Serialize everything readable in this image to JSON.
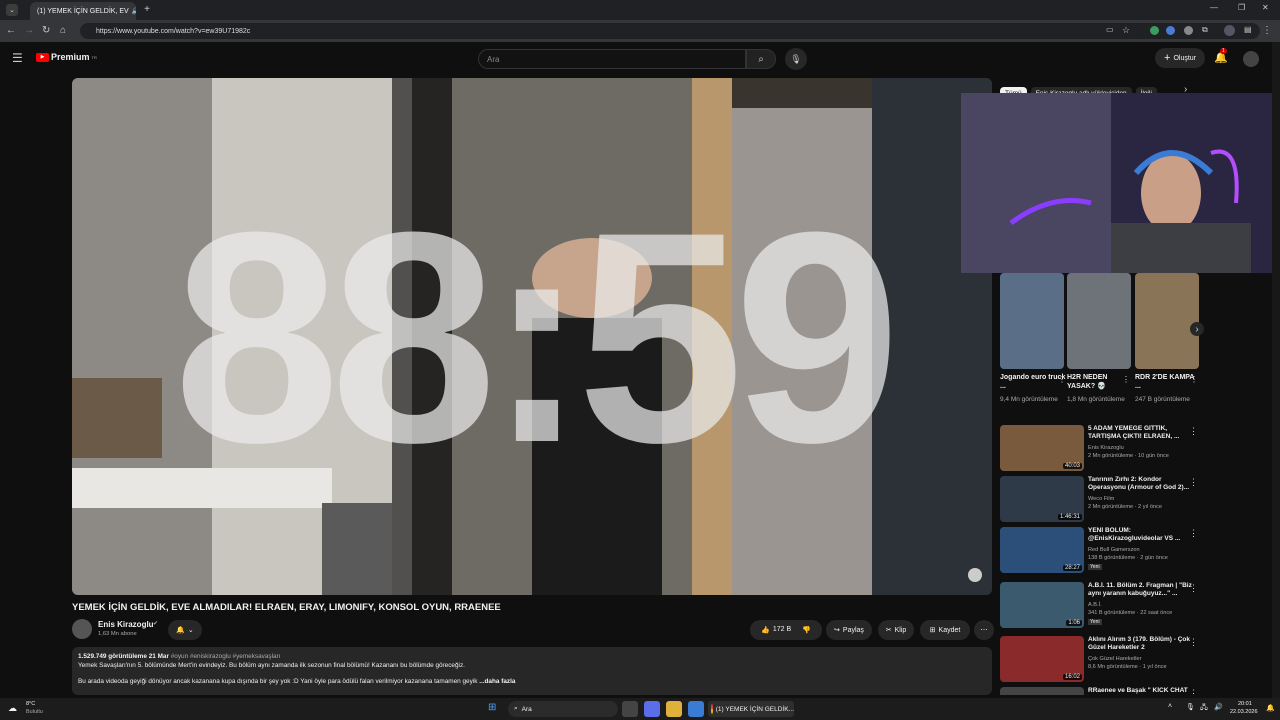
{
  "browser": {
    "tab_title": "(1) YEMEK İÇİN GELDİK, EV",
    "url": "https://www.youtube.com/watch?v=ew39U71982c"
  },
  "youtube": {
    "logo": "Premium",
    "logo_sup": "TR",
    "search_placeholder": "Ara",
    "create_label": "Oluştur",
    "notif_count": "1"
  },
  "video": {
    "timer": "88:59",
    "title": "YEMEK İÇİN GELDİK, EVE ALMADILAR! ELRAEN, ERAY, LIMONIFY, KONSOL OYUN, RRAENEE",
    "channel": "Enis Kirazoglu",
    "subs": "1,63 Mn abone",
    "likes": "172 B",
    "share": "Paylaş",
    "clip": "Klip",
    "save": "Kaydet"
  },
  "description": {
    "views": "1.529.749 görüntüleme",
    "date": "21 Mar",
    "tags": "#oyun #eniskirazoglu #yemeksavaşları",
    "line1": "Yemek Savaşları'nın 5. bölümünde Mert'in evindeyiz. Bu bölüm aynı zamanda ilk sezonun final bölümü! Kazananı bu bölümde göreceğiz.",
    "line2": "Bu arada videoda geyiği dönüyor ancak kazanana kupa dışında bir şey yok :D Yani öyle para ödülü falan verilmiyor kazanana tamamen geyik",
    "more": "...daha fazla"
  },
  "chips": [
    "Tümü",
    "Enis Kirazoglu adlı yükleyiciden",
    "İlgili"
  ],
  "shorts": [
    {
      "title": "Jogando euro truck ...",
      "views": "9,4 Mn görüntüleme",
      "color": "#5a6e88"
    },
    {
      "title": "H2R NEDEN YASAK? 💀",
      "views": "1,8 Mn görüntüleme",
      "color": "#6d7378"
    },
    {
      "title": "RDR 2'DE KAMPA ...",
      "views": "247 B görüntüleme",
      "color": "#8a7458"
    }
  ],
  "recs": [
    {
      "title": "5 ADAM YEMEĞE GİTTİK, TARTIŞMA ÇIKTI! ELRAEN, ...",
      "channel": "Enis Kirazoglu",
      "meta": "2 Mn görüntüleme · 10 gün önce",
      "dur": "40:03",
      "color": "#7a5a3c",
      "badge": ""
    },
    {
      "title": "Tanrının Zırhı 2: Kondor Operasyonu (Armour of God 2)...",
      "channel": "Weco Film",
      "meta": "2 Mn görüntüleme · 2 yıl önce",
      "dur": "1:46:31",
      "color": "#2f3a48",
      "badge": ""
    },
    {
      "title": "YENİ BÖLÜM: @EnisKirazogluvideolar VS ...",
      "channel": "Red Bull Gamerszon",
      "meta": "138 B görüntüleme · 2 gün önce",
      "dur": "28:27",
      "color": "#2c4f7a",
      "badge": "Yeni"
    },
    {
      "title": "A.B.İ. 11. Bölüm 2. Fragman | \"Biz aynı yaranın kabuğuyuz...\" ...",
      "channel": "A.B.İ.",
      "meta": "341 B görüntüleme · 22 saat önce",
      "dur": "1:06",
      "color": "#3c5a6e",
      "badge": "Yeni"
    },
    {
      "title": "Aklını Alırım 3 (179. Bölüm) - Çok Güzel Hareketler 2",
      "channel": "Çok Güzel Hareketler",
      "meta": "8,6 Mn görüntüleme · 1 yıl önce",
      "dur": "16:02",
      "color": "#8a2a2a",
      "badge": ""
    },
    {
      "title": "RRaenee ve Başak \" KİCK CHAT",
      "channel": "",
      "meta": "",
      "dur": "",
      "color": "#444",
      "badge": ""
    }
  ],
  "taskbar": {
    "temp": "8°C",
    "weather": "Bulutlu",
    "search": "Ara",
    "active_app": "(1) YEMEK İÇİN GELDİK...",
    "time": "20:01",
    "date": "22.03.2026"
  }
}
